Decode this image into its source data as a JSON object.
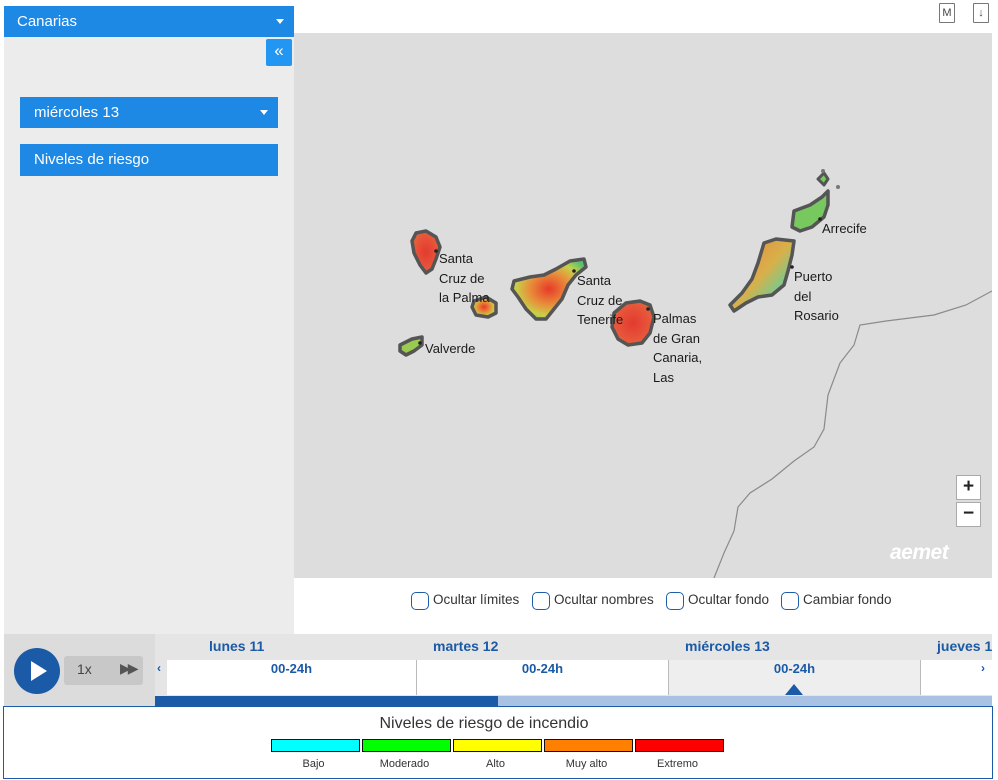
{
  "sidebar": {
    "region": "Canarias",
    "collapse_icon": "«",
    "day": "miércoles 13",
    "layer": "Niveles de riesgo"
  },
  "toolbar": {
    "map_icon_label": "M",
    "download_icon_label": "↓"
  },
  "map": {
    "labels": {
      "santa_cruz_palma": [
        "Santa",
        "Cruz de",
        "la Palma"
      ],
      "santa_cruz_tenerife": [
        "Santa",
        "Cruz de",
        "Tenerife"
      ],
      "palmas": [
        "Palmas",
        "de Gran",
        "Canaria,",
        "Las"
      ],
      "valverde": "Valverde",
      "arrecife": "Arrecife",
      "puerto_rosario": [
        "Puerto",
        "del",
        "Rosario"
      ]
    },
    "zoom_in": "+",
    "zoom_out": "−",
    "logo": "aemet",
    "colors": {
      "background": "#dddddd",
      "island_border": "#555555"
    }
  },
  "options": [
    "Ocultar límites",
    "Ocultar nombres",
    "Ocultar fondo",
    "Cambiar fondo"
  ],
  "timeline": {
    "speed": "1x",
    "days": [
      {
        "name": "lunes 11",
        "slot": "00-24h"
      },
      {
        "name": "martes 12",
        "slot": "00-24h"
      },
      {
        "name": "miércoles 13",
        "slot": "00-24h"
      },
      {
        "name": "jueves 1",
        "slot": ""
      }
    ],
    "progress_fraction": 0.41
  },
  "legend": {
    "title": "Niveles de riesgo de incendio",
    "levels": [
      {
        "label": "Bajo",
        "color": "#00ffff"
      },
      {
        "label": "Moderado",
        "color": "#00ff00"
      },
      {
        "label": "Alto",
        "color": "#ffff00"
      },
      {
        "label": "Muy alto",
        "color": "#ff8000"
      },
      {
        "label": "Extremo",
        "color": "#ff0000"
      }
    ]
  }
}
